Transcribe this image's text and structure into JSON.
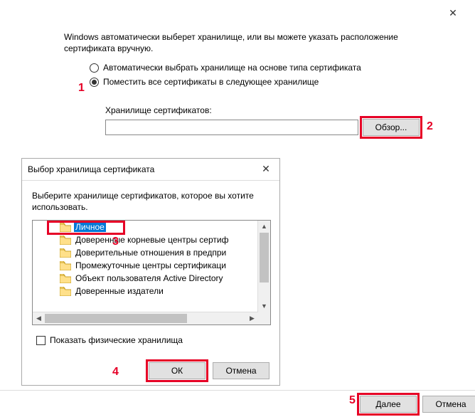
{
  "wizard": {
    "intro": "Windows автоматически выберет хранилище, или вы можете указать расположение сертификата вручную.",
    "options": {
      "auto": "Автоматически выбрать хранилище на основе типа сертификата",
      "manual": "Поместить все сертификаты в следующее хранилище",
      "selected": "manual"
    },
    "store_label": "Хранилище сертификатов:",
    "store_value": "",
    "browse_label": "Обзор...",
    "next_label": "Далее",
    "cancel_label": "Отмена"
  },
  "dialog": {
    "title": "Выбор хранилища сертификата",
    "instruction": "Выберите хранилище сертификатов, которое вы хотите использовать.",
    "tree": [
      "Личное",
      "Доверенные корневые центры сертиф",
      "Доверительные отношения в предпри",
      "Промежуточные центры сертификаци",
      "Объект пользователя Active Directory",
      "Доверенные издатели"
    ],
    "selected_index": 0,
    "show_physical_label": "Показать физические хранилища",
    "ok_label": "ОК",
    "cancel_label": "Отмена"
  },
  "annotations": {
    "n1": "1",
    "n2": "2",
    "n3": "3",
    "n4": "4",
    "n5": "5"
  }
}
